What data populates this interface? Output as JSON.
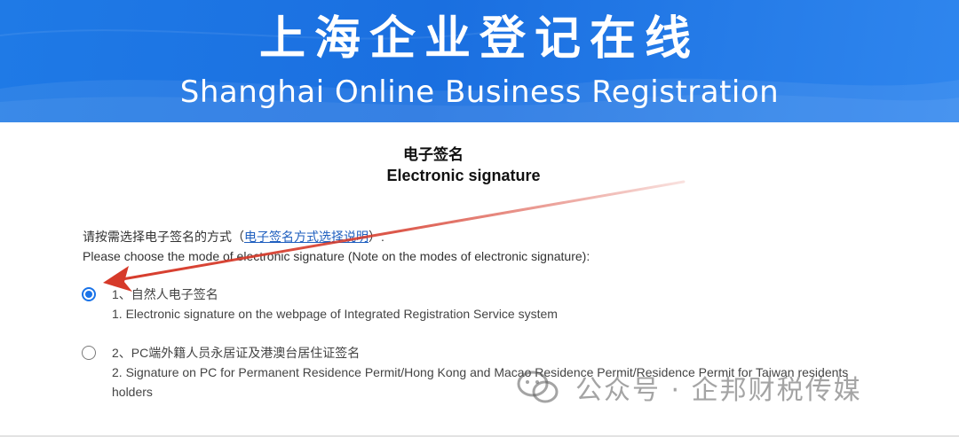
{
  "banner": {
    "title_cn": "上海企业登记在线",
    "title_en": "Shanghai Online Business Registration"
  },
  "heading": {
    "cn": "电子签名",
    "en": "Electronic signature"
  },
  "instruction": {
    "cn_prefix": "请按需选择电子签名的方式（",
    "cn_link": "电子签名方式选择说明",
    "cn_suffix": "）.",
    "en": "Please choose the mode of electronic signature (Note on the modes of electronic signature):"
  },
  "options": [
    {
      "cn": "1、自然人电子签名",
      "en": "1. Electronic signature on the webpage of Integrated Registration Service system",
      "selected": true
    },
    {
      "cn": "2、PC端外籍人员永居证及港澳台居住证签名",
      "en": "2. Signature on PC for Permanent Residence Permit/Hong Kong and Macao Residence Permit/Residence Permit for Taiwan residents holders",
      "selected": false
    }
  ],
  "watermark": {
    "text": "公众号 · 企邦财税传媒",
    "icon": "wechat-icon"
  },
  "colors": {
    "banner_blue": "#1a6fe0",
    "radio_blue": "#1a73e8",
    "arrow_red": "#d63a2a",
    "link_blue": "#1f5fbf"
  }
}
